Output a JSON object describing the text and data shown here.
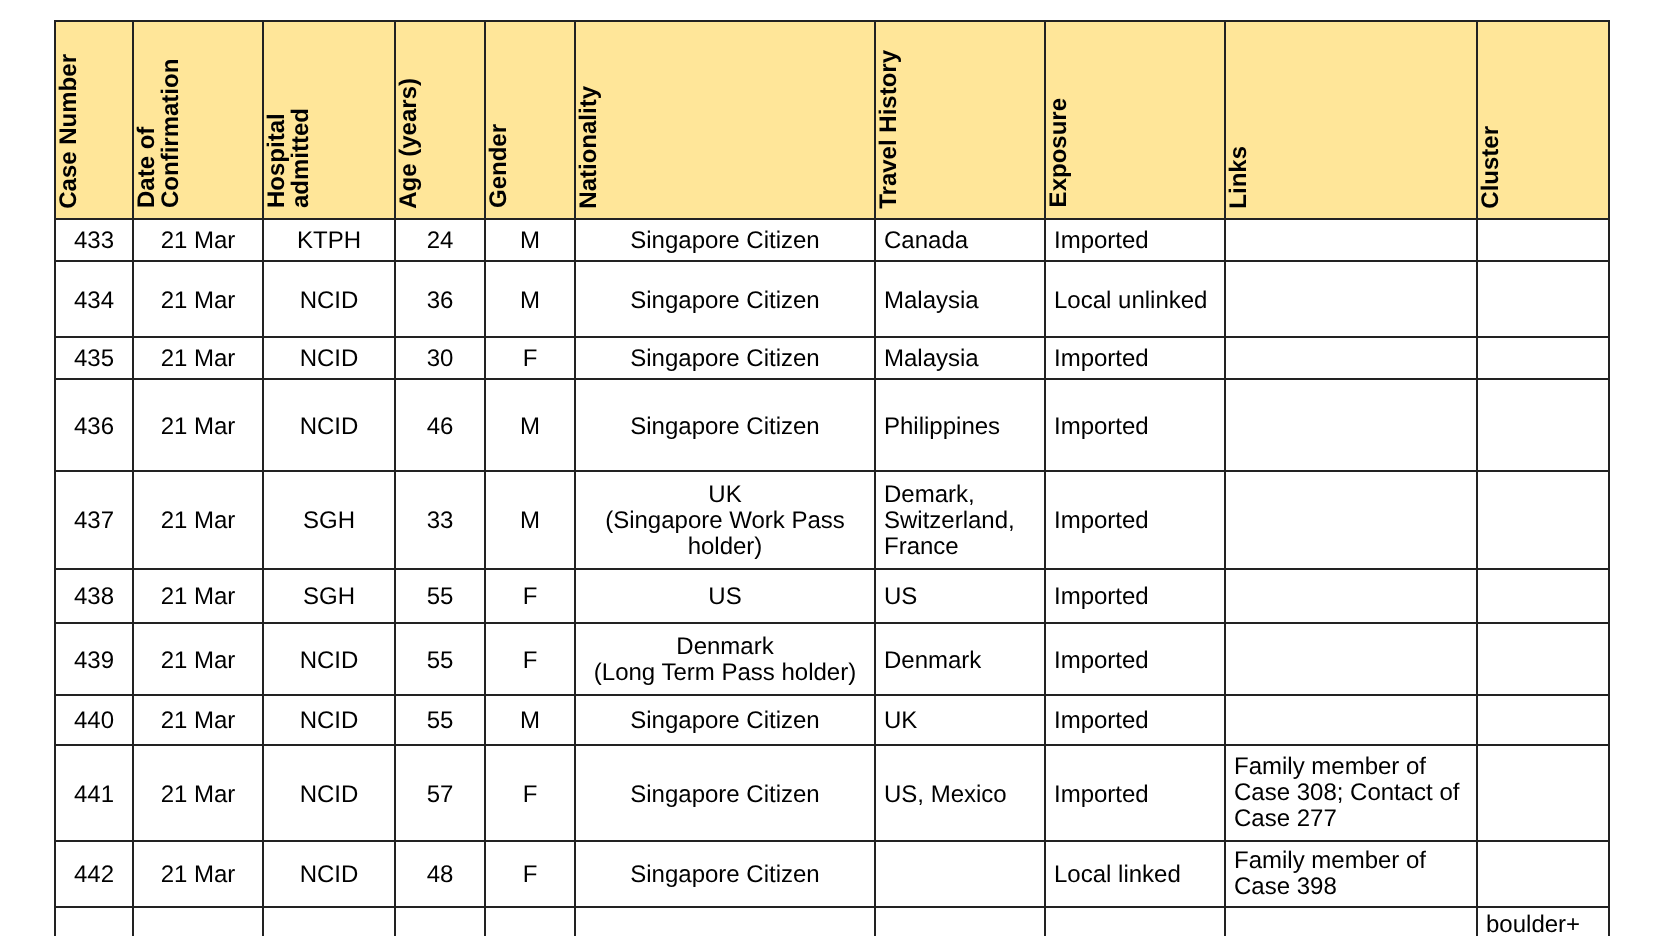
{
  "table": {
    "columns": [
      "Case Number",
      "Date of Confirmation",
      "Hospital admitted",
      "Age (years)",
      "Gender",
      "Nationality",
      "Travel History",
      "Exposure",
      "Links",
      "Cluster"
    ],
    "rows": [
      {
        "cells": [
          "433",
          "21 Mar",
          "KTPH",
          "24",
          "M",
          "Singapore Citizen",
          "Canada",
          "Imported",
          "",
          ""
        ]
      },
      {
        "cells": [
          "434",
          "21 Mar",
          "NCID",
          "36",
          "M",
          "Singapore Citizen",
          "Malaysia",
          "Local unlinked",
          "",
          ""
        ]
      },
      {
        "cells": [
          "435",
          "21 Mar",
          "NCID",
          "30",
          "F",
          "Singapore Citizen",
          "Malaysia",
          "Imported",
          "",
          ""
        ]
      },
      {
        "cells": [
          "436",
          "21 Mar",
          "NCID",
          "46",
          "M",
          "Singapore Citizen",
          "Philippines",
          "Imported",
          "",
          ""
        ]
      },
      {
        "cells": [
          "437",
          "21 Mar",
          "SGH",
          "33",
          "M",
          "UK\n(Singapore Work Pass holder)",
          "Demark, Switzerland, France",
          "Imported",
          "",
          ""
        ]
      },
      {
        "cells": [
          "438",
          "21 Mar",
          "SGH",
          "55",
          "F",
          "US",
          "US",
          "Imported",
          "",
          ""
        ]
      },
      {
        "cells": [
          "439",
          "21 Mar",
          "NCID",
          "55",
          "F",
          "Denmark\n(Long Term Pass holder)",
          "Denmark",
          "Imported",
          "",
          ""
        ]
      },
      {
        "cells": [
          "440",
          "21 Mar",
          "NCID",
          "55",
          "M",
          "Singapore Citizen",
          "UK",
          "Imported",
          "",
          ""
        ]
      },
      {
        "cells": [
          "441",
          "21 Mar",
          "NCID",
          "57",
          "F",
          "Singapore Citizen",
          "US, Mexico",
          "Imported",
          "Family member of Case 308; Contact of Case 277",
          ""
        ]
      },
      {
        "cells": [
          "442",
          "21 Mar",
          "NCID",
          "48",
          "F",
          "Singapore Citizen",
          "",
          "Local linked",
          "Family member of Case 398",
          ""
        ]
      },
      {
        "cells": [
          "",
          "",
          "",
          "",
          "",
          "",
          "",
          "",
          "",
          "boulder+"
        ]
      }
    ]
  }
}
